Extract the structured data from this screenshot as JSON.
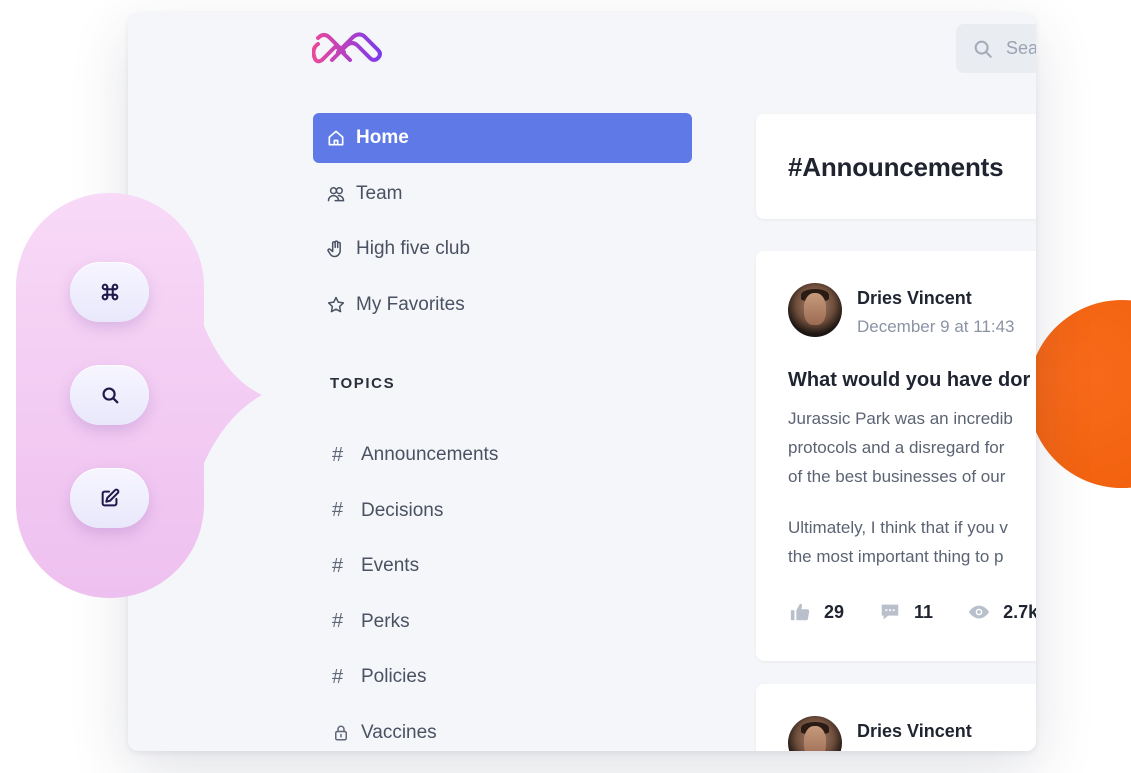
{
  "app": {
    "search": {
      "placeholder": "Sea"
    }
  },
  "nav": {
    "items": [
      {
        "label": "Home",
        "icon": "home-icon",
        "active": true
      },
      {
        "label": "Team",
        "icon": "team-icon",
        "active": false
      },
      {
        "label": "High five club",
        "icon": "hand-icon",
        "active": false
      },
      {
        "label": "My Favorites",
        "icon": "star-icon",
        "active": false
      }
    ]
  },
  "topics": {
    "heading": "TOPICS",
    "items": [
      {
        "label": "Announcements",
        "icon": "hash-icon"
      },
      {
        "label": "Decisions",
        "icon": "hash-icon"
      },
      {
        "label": "Events",
        "icon": "hash-icon"
      },
      {
        "label": "Perks",
        "icon": "hash-icon"
      },
      {
        "label": "Policies",
        "icon": "hash-icon"
      },
      {
        "label": "Vaccines",
        "icon": "lock-icon"
      }
    ]
  },
  "feed": {
    "channel_title": "#Announcements",
    "posts": [
      {
        "author": "Dries Vincent",
        "date": "December 9 at 11:43",
        "title": "What would you have dor",
        "body_lines_1": [
          "Jurassic Park was an incredib",
          "protocols and a disregard for",
          "of the best businesses of our"
        ],
        "body_lines_2": [
          "Ultimately, I think that if you v",
          "the most important thing to p"
        ],
        "likes": "29",
        "comments": "11",
        "views": "2.7k"
      },
      {
        "author": "Dries Vincent"
      }
    ]
  },
  "fab": {
    "buttons": [
      {
        "icon": "command-icon"
      },
      {
        "icon": "search-icon"
      },
      {
        "icon": "edit-icon"
      }
    ]
  },
  "colors": {
    "accent": "#5f7ae6",
    "orange": "#f2620f",
    "bubble": "#f3c8f3",
    "logo_start": "#ec4899",
    "logo_end": "#7c3aed"
  }
}
